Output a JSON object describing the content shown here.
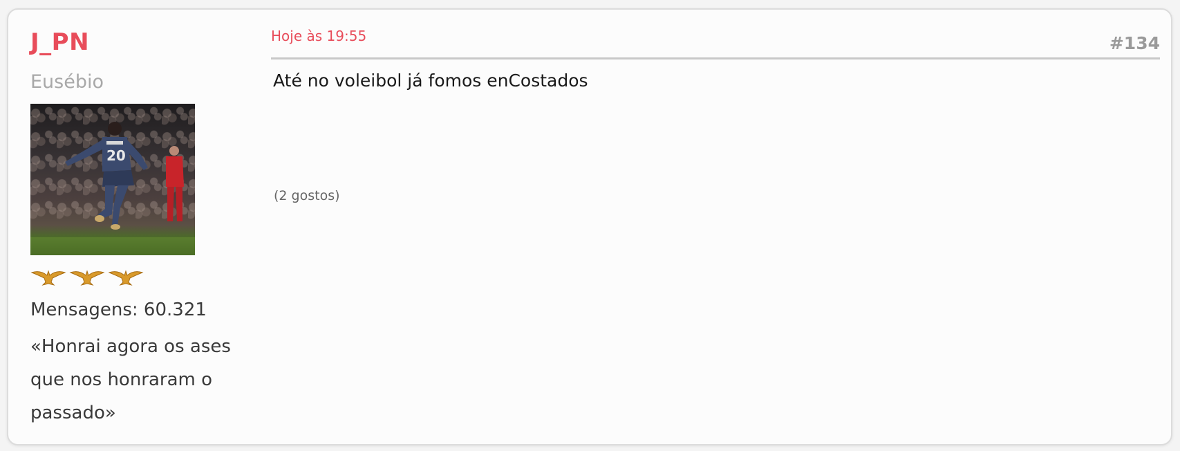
{
  "author": {
    "username": "J_PN",
    "rank_title": "Eusébio",
    "avatar_icon": "football-player-photo",
    "rank_icons": [
      "eagle-icon",
      "eagle-icon",
      "eagle-icon"
    ],
    "message_count": "Mensagens: 60.321",
    "signature": "«Honrai agora os ases que nos honraram o passado»"
  },
  "post": {
    "timestamp": "Hoje às 19:55",
    "number": "#134",
    "body": "Até no voleibol já fomos enCostados",
    "likes": "(2 gostos)"
  },
  "colors": {
    "accent": "#e84c5a",
    "muted": "#a8a8a8",
    "text": "#1a1a1a",
    "eagle": "#d99a2b"
  }
}
